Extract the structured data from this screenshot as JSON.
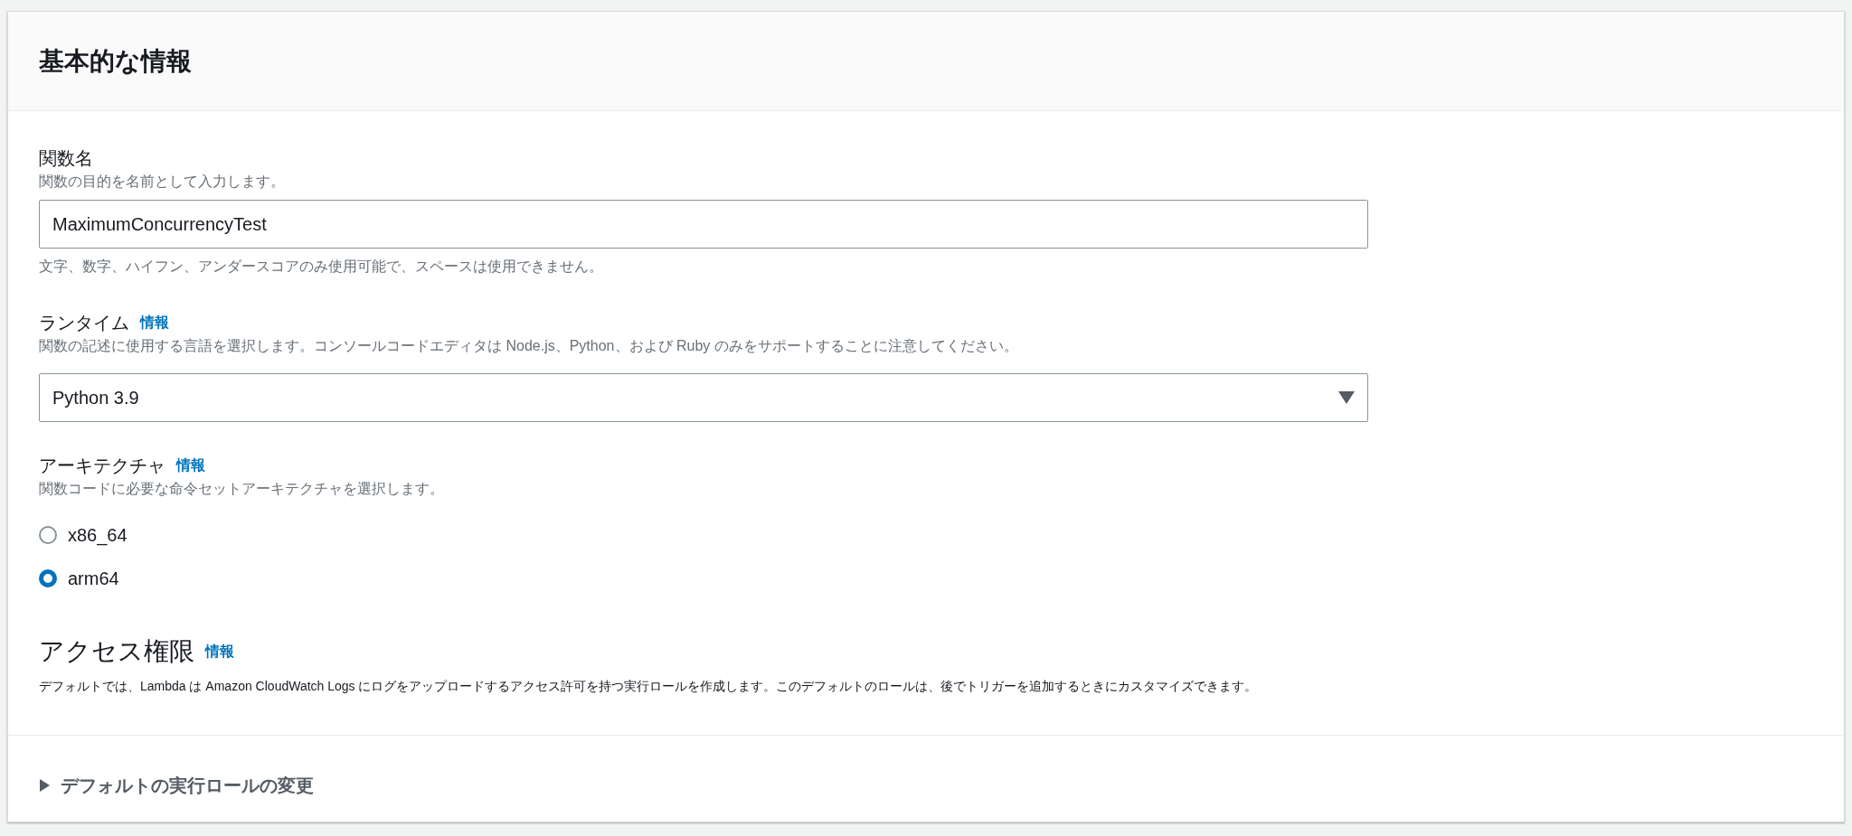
{
  "panel": {
    "title": "基本的な情報"
  },
  "function_name": {
    "label": "関数名",
    "description": "関数の目的を名前として入力します。",
    "value": "MaximumConcurrencyTest",
    "constraint": "文字、数字、ハイフン、アンダースコアのみ使用可能で、スペースは使用できません。"
  },
  "runtime": {
    "label": "ランタイム",
    "info_link": "情報",
    "description": "関数の記述に使用する言語を選択します。コンソールコードエディタは Node.js、Python、および Ruby のみをサポートすることに注意してください。",
    "value": "Python 3.9"
  },
  "architecture": {
    "label": "アーキテクチャ",
    "info_link": "情報",
    "description": "関数コードに必要な命令セットアーキテクチャを選択します。",
    "options": [
      {
        "label": "x86_64",
        "selected": false
      },
      {
        "label": "arm64",
        "selected": true
      }
    ]
  },
  "permissions": {
    "title": "アクセス権限",
    "info_link": "情報",
    "description": "デフォルトでは、Lambda は Amazon CloudWatch Logs にログをアップロードするアクセス許可を持つ実行ロールを作成します。このデフォルトのロールは、後でトリガーを追加するときにカスタマイズできます。"
  },
  "expander": {
    "label": "デフォルトの実行ロールの変更",
    "expanded": false
  }
}
